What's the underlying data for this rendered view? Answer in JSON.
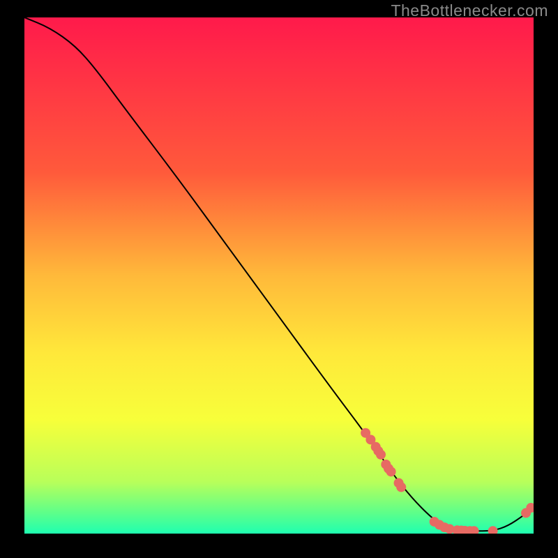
{
  "watermark": "TheBottlenecker.com",
  "chart_data": {
    "type": "line",
    "title": "",
    "xlabel": "",
    "ylabel": "",
    "xlim": [
      0,
      100
    ],
    "ylim": [
      0,
      100
    ],
    "grid": false,
    "gradient_stops": [
      {
        "offset": 0.0,
        "color": "#ff1a4b"
      },
      {
        "offset": 0.3,
        "color": "#ff5a3b"
      },
      {
        "offset": 0.5,
        "color": "#ffb93a"
      },
      {
        "offset": 0.65,
        "color": "#ffe83a"
      },
      {
        "offset": 0.78,
        "color": "#f7ff3a"
      },
      {
        "offset": 0.9,
        "color": "#b8ff5a"
      },
      {
        "offset": 0.96,
        "color": "#5dff8a"
      },
      {
        "offset": 1.0,
        "color": "#1fffb0"
      }
    ],
    "series": [
      {
        "name": "curve",
        "type": "line",
        "color": "#000000",
        "points": [
          {
            "x": 0,
            "y": 100
          },
          {
            "x": 5,
            "y": 98
          },
          {
            "x": 10,
            "y": 94.5
          },
          {
            "x": 14,
            "y": 90
          },
          {
            "x": 20,
            "y": 82
          },
          {
            "x": 30,
            "y": 69
          },
          {
            "x": 40,
            "y": 55.5
          },
          {
            "x": 50,
            "y": 42
          },
          {
            "x": 60,
            "y": 28.5
          },
          {
            "x": 68,
            "y": 18
          },
          {
            "x": 72,
            "y": 12
          },
          {
            "x": 76,
            "y": 7
          },
          {
            "x": 80,
            "y": 3
          },
          {
            "x": 83,
            "y": 1
          },
          {
            "x": 88,
            "y": 0.5
          },
          {
            "x": 92,
            "y": 0.5
          },
          {
            "x": 95,
            "y": 1.5
          },
          {
            "x": 98,
            "y": 3.5
          },
          {
            "x": 100,
            "y": 5
          }
        ]
      },
      {
        "name": "markers",
        "type": "scatter",
        "color": "#e76a63",
        "radius": 7,
        "points": [
          {
            "x": 67,
            "y": 19.5
          },
          {
            "x": 68,
            "y": 18.2
          },
          {
            "x": 69,
            "y": 16.8
          },
          {
            "x": 69.5,
            "y": 16
          },
          {
            "x": 70,
            "y": 15.3
          },
          {
            "x": 71,
            "y": 13.4
          },
          {
            "x": 71.5,
            "y": 12.6
          },
          {
            "x": 72,
            "y": 12
          },
          {
            "x": 73.5,
            "y": 9.8
          },
          {
            "x": 74,
            "y": 9
          },
          {
            "x": 80.5,
            "y": 2.3
          },
          {
            "x": 81.5,
            "y": 1.7
          },
          {
            "x": 82.5,
            "y": 1.2
          },
          {
            "x": 83.5,
            "y": 0.9
          },
          {
            "x": 85,
            "y": 0.65
          },
          {
            "x": 85.8,
            "y": 0.6
          },
          {
            "x": 86.5,
            "y": 0.55
          },
          {
            "x": 87.5,
            "y": 0.5
          },
          {
            "x": 88.3,
            "y": 0.5
          },
          {
            "x": 92,
            "y": 0.5
          },
          {
            "x": 98.5,
            "y": 4
          },
          {
            "x": 99.5,
            "y": 5
          }
        ]
      }
    ]
  }
}
